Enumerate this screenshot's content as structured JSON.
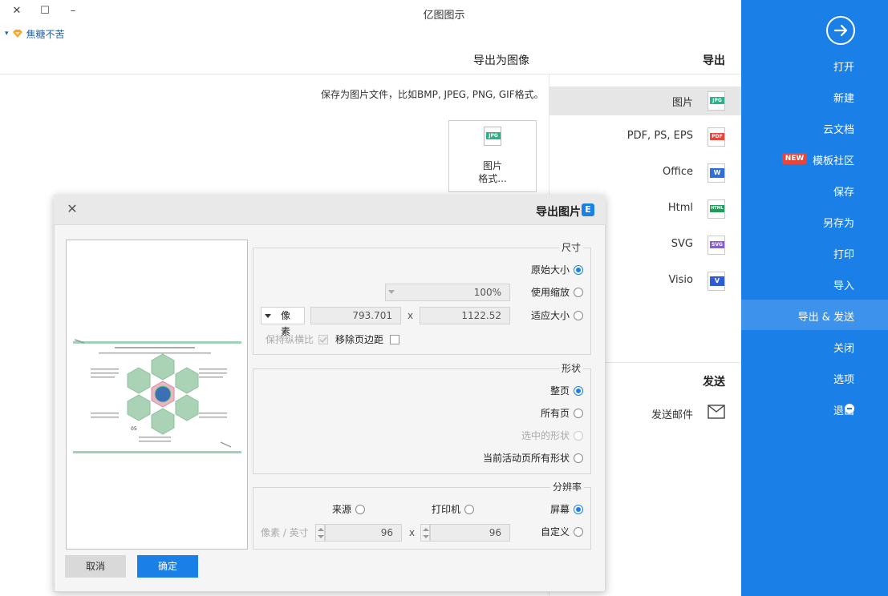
{
  "window": {
    "title": "亿图图示",
    "minimize": "–",
    "maximize": "☐",
    "close": "✕"
  },
  "user": {
    "name": "焦糖不苦",
    "dropdown": "▾"
  },
  "menu": {
    "items": [
      {
        "label": "打开"
      },
      {
        "label": "新建"
      },
      {
        "label": "云文档"
      },
      {
        "label": "模板社区"
      },
      {
        "label": "保存"
      },
      {
        "label": "另存为"
      },
      {
        "label": "打印"
      },
      {
        "label": "导入"
      },
      {
        "label": "导出 & 发送"
      },
      {
        "label": "关闭"
      },
      {
        "label": "选项"
      },
      {
        "label": "退出"
      }
    ],
    "new_badge": "NEW",
    "accent": "#1a7fe6"
  },
  "export_panel": {
    "header": "导出",
    "types": [
      {
        "label": "图片",
        "tag": "JPG",
        "color": "#2bb18c"
      },
      {
        "label": "PDF, PS, EPS",
        "tag": "PDF",
        "color": "#e8463c"
      },
      {
        "label": "Office",
        "tag": "W",
        "color": "#2f6fd6"
      },
      {
        "label": "Html",
        "tag": "HTML",
        "color": "#1f9a5a"
      },
      {
        "label": "SVG",
        "tag": "SVG",
        "color": "#8a5bd6"
      },
      {
        "label": "Visio",
        "tag": "V",
        "color": "#2f5bd6"
      }
    ],
    "send_header": "发送",
    "send_label": "发送邮件"
  },
  "export_image": {
    "header": "导出为图像",
    "description": "保存为图片文件，比如BMP, JPEG, PNG, GIF格式。",
    "card_label_1": "图片",
    "card_label_2": "格式..."
  },
  "dialog": {
    "title": "导出图片",
    "logo": "E",
    "close": "✕",
    "size": {
      "legend": "尺寸",
      "options": [
        "原始大小",
        "使用缩放",
        "适应大小"
      ],
      "selected": "原始大小",
      "zoom_value": "100%",
      "width": "1122.52",
      "height": "793.701",
      "x": "x",
      "unit": "像素",
      "remove_margin": "移除页边距",
      "keep_ratio": "保持纵横比"
    },
    "shape": {
      "legend": "形状",
      "options": [
        "整页",
        "所有页",
        "选中的形状",
        "当前活动页所有形状"
      ],
      "selected": "整页"
    },
    "resolution": {
      "legend": "分辨率",
      "options": [
        "屏幕",
        "打印机",
        "来源",
        "自定义"
      ],
      "selected": "屏幕",
      "dpi_x": "96",
      "dpi_y": "96",
      "x": "x",
      "unit": "像素 / 英寸"
    },
    "thumbnail": {
      "title": "图形的坐标轴",
      "center_label": "05"
    },
    "ok": "确定",
    "cancel": "取消"
  }
}
